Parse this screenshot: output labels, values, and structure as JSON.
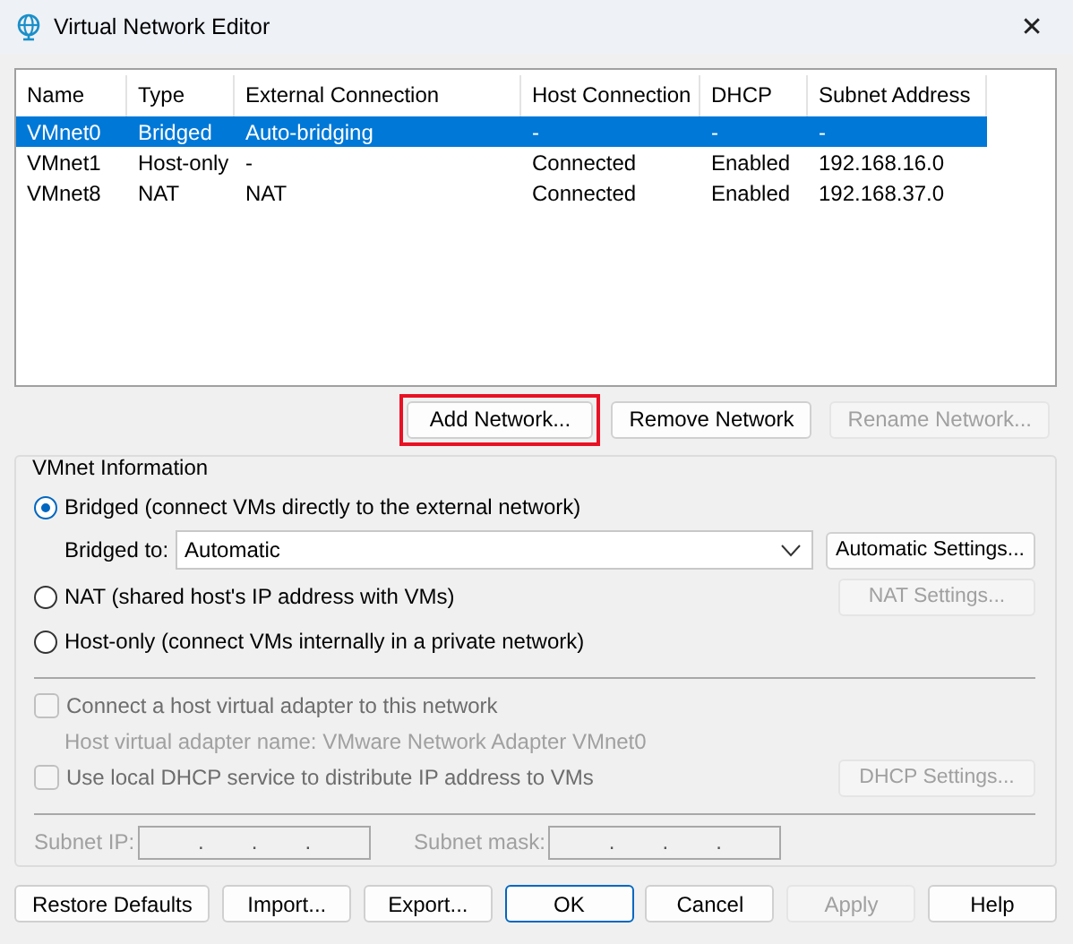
{
  "window": {
    "title": "Virtual Network Editor",
    "close": "✕"
  },
  "table": {
    "columns": [
      "Name",
      "Type",
      "External Connection",
      "Host Connection",
      "DHCP",
      "Subnet Address"
    ],
    "rows": [
      {
        "cells": [
          "VMnet0",
          "Bridged",
          "Auto-bridging",
          "-",
          "-",
          "-"
        ],
        "selected": true
      },
      {
        "cells": [
          "VMnet1",
          "Host-only",
          "-",
          "Connected",
          "Enabled",
          "192.168.16.0"
        ],
        "selected": false
      },
      {
        "cells": [
          "VMnet8",
          "NAT",
          "NAT",
          "Connected",
          "Enabled",
          "192.168.37.0"
        ],
        "selected": false
      }
    ]
  },
  "network_buttons": [
    {
      "label": "Add Network...",
      "disabled": false,
      "highlighted": true
    },
    {
      "label": "Remove Network",
      "disabled": false,
      "highlighted": false
    },
    {
      "label": "Rename Network...",
      "disabled": true,
      "highlighted": false
    }
  ],
  "vmnet_info": {
    "title": "VMnet Information",
    "modes": [
      {
        "label": "Bridged (connect VMs directly to the external network)",
        "selected": true
      },
      {
        "label": "NAT (shared host's IP address with VMs)",
        "selected": false,
        "button": {
          "label": "NAT Settings...",
          "disabled": true
        }
      },
      {
        "label": "Host-only (connect VMs internally in a private network)",
        "selected": false
      }
    ],
    "bridged_to": {
      "label": "Bridged to:",
      "value": "Automatic",
      "button": {
        "label": "Automatic Settings...",
        "disabled": false
      }
    },
    "host_adapter": {
      "label": "Connect a host virtual adapter to this network",
      "checked": false,
      "disabled": true
    },
    "adapter_name": "Host virtual adapter name: VMware Network Adapter VMnet0",
    "dhcp": {
      "label": "Use local DHCP service to distribute IP address to VMs",
      "checked": false,
      "disabled": true,
      "button": {
        "label": "DHCP Settings...",
        "disabled": true
      }
    },
    "subnet_ip": {
      "label": "Subnet IP:",
      "dots": [
        ".",
        ".",
        "."
      ]
    },
    "subnet_mask": {
      "label": "Subnet mask:",
      "dots": [
        ".",
        ".",
        "."
      ]
    }
  },
  "footer_buttons": [
    {
      "label": "Restore Defaults",
      "disabled": false,
      "default": false
    },
    {
      "label": "Import...",
      "disabled": false,
      "default": false
    },
    {
      "label": "Export...",
      "disabled": false,
      "default": false
    },
    {
      "label": "OK",
      "disabled": false,
      "default": true
    },
    {
      "label": "Cancel",
      "disabled": false,
      "default": false
    },
    {
      "label": "Apply",
      "disabled": true,
      "default": false
    },
    {
      "label": "Help",
      "disabled": false,
      "default": false
    }
  ]
}
